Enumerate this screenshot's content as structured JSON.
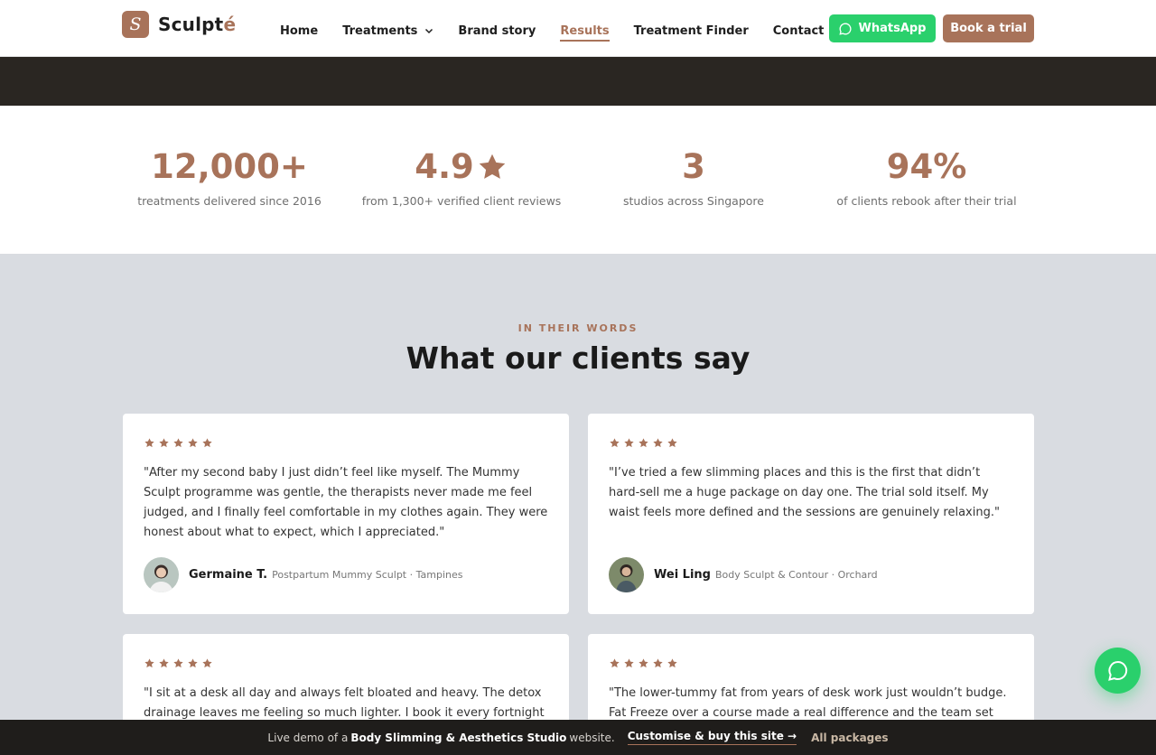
{
  "brand": {
    "mark": "S",
    "name_main": "Sculpt",
    "name_accent": "é"
  },
  "nav": [
    {
      "label": "Home"
    },
    {
      "label": "Treatments",
      "has_dropdown": true
    },
    {
      "label": "Brand story"
    },
    {
      "label": "Results",
      "active": true
    },
    {
      "label": "Treatment Finder"
    },
    {
      "label": "Contact"
    }
  ],
  "header": {
    "whatsapp_label": "WhatsApp",
    "trial_label": "Book a trial"
  },
  "stats": [
    {
      "value": "12,000+",
      "label": "treatments delivered since 2016"
    },
    {
      "value": "4.9",
      "star": true,
      "label": "from 1,300+ verified client reviews"
    },
    {
      "value": "3",
      "label": "studios across Singapore"
    },
    {
      "value": "94%",
      "label": "of clients rebook after their trial"
    }
  ],
  "testimonials": {
    "eyebrow": "IN THEIR WORDS",
    "title": "What our clients say",
    "rating": 5,
    "cards": [
      {
        "quote": "\"After my second baby I just didn’t feel like myself. The Mummy Sculpt programme was gentle, the therapists never made me feel judged, and I finally feel comfortable in my clothes again. They were honest about what to expect, which I appreciated.\"",
        "name": "Germaine T.",
        "meta": "Postpartum Mummy Sculpt · Tampines"
      },
      {
        "quote": "\"I’ve tried a few slimming places and this is the first that didn’t hard-sell me a huge package on day one. The trial sold itself. My waist feels more defined and the sessions are genuinely relaxing.\"",
        "name": "Wei Ling",
        "meta": "Body Sculpt & Contour · Orchard"
      },
      {
        "quote": "\"I sit at a desk all day and always felt bloated and heavy. The detox drainage leaves me feeling so much lighter. I book it every fortnight",
        "name": "",
        "meta": ""
      },
      {
        "quote": "\"The lower-tummy fat from years of desk work just wouldn’t budge. Fat Freeze over a course made a real difference and the team set",
        "name": "",
        "meta": ""
      }
    ]
  },
  "demo_bar": {
    "prefix": "Live demo of a",
    "bold": "Body Slimming & Aesthetics Studio",
    "suffix": "website.",
    "cta": "Customise & buy this site →",
    "packages": "All packages"
  },
  "colors": {
    "accent": "#a8735a",
    "whatsapp": "#2ad06c",
    "dark": "#2a2622",
    "section_bg": "#d9dce1"
  },
  "icons": {
    "whatsapp": "whatsapp-icon",
    "chat": "chat-bubble-icon",
    "star": "star-icon",
    "chevron": "chevron-down-icon"
  }
}
